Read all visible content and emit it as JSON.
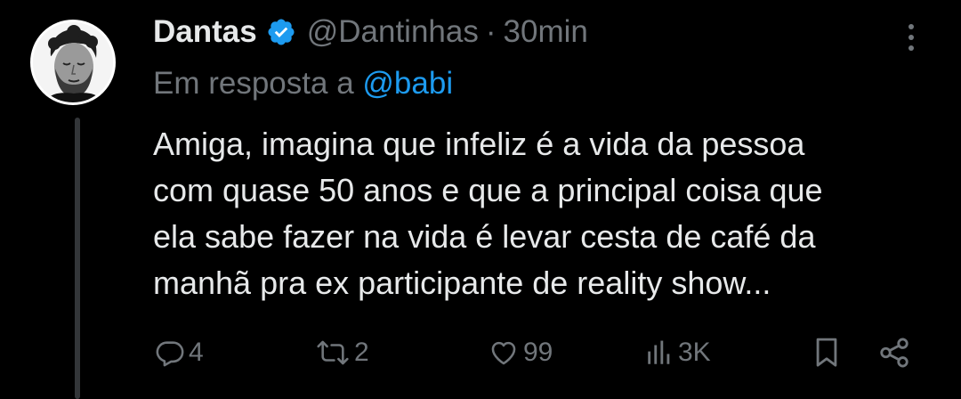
{
  "author": {
    "display_name": "Dantas",
    "handle": "@Dantinhas",
    "separator": "·",
    "time": "30min"
  },
  "reply": {
    "prefix": "Em resposta a",
    "handle": "@babi"
  },
  "body": {
    "lines": [
      "Amiga, imagina que infeliz é a vida da pessoa",
      "com quase 50 anos e que a principal coisa que",
      "ela sabe fazer na vida é levar cesta de café da",
      "manhã pra ex participante de reality show..."
    ]
  },
  "actions": {
    "replies": "4",
    "retweets": "2",
    "likes": "99",
    "views": "3K"
  },
  "colors": {
    "background": "#000000",
    "text": "#e7e9ea",
    "muted": "#71767b",
    "accent": "#1d9bf0",
    "thread_line": "#333639"
  },
  "icons": {
    "verified": "verified-badge-icon",
    "more": "more-vertical-icon",
    "reply": "reply-icon",
    "retweet": "retweet-icon",
    "like": "heart-icon",
    "views": "views-icon",
    "bookmark": "bookmark-icon",
    "share": "share-icon"
  }
}
